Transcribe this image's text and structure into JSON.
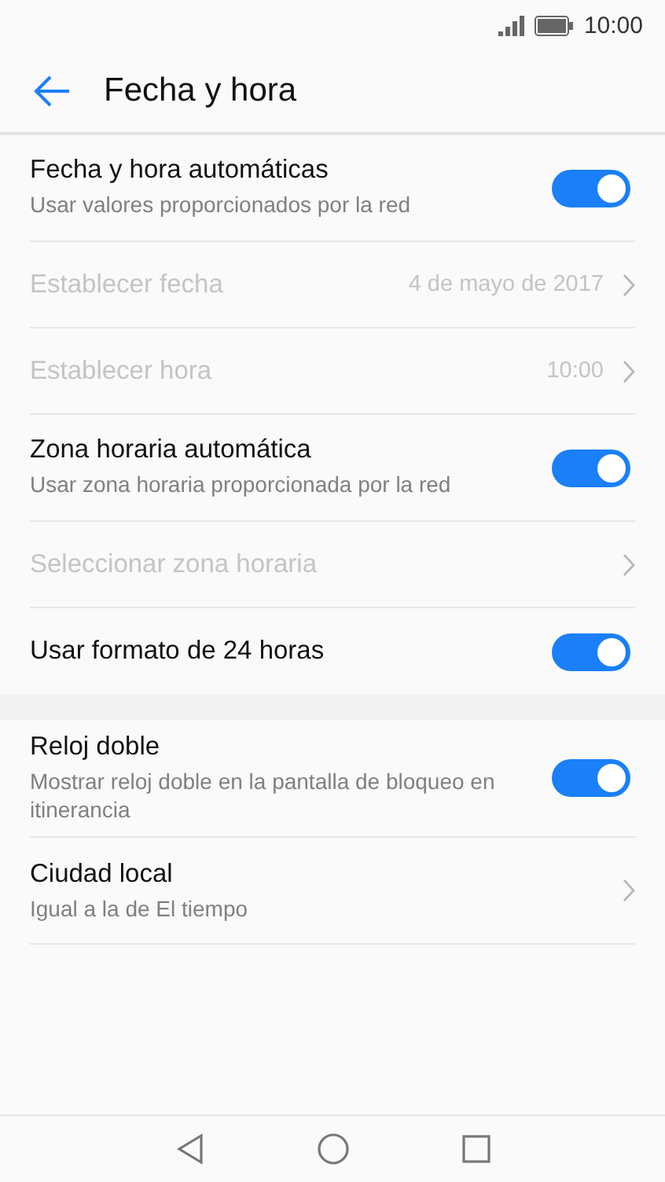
{
  "status_bar": {
    "time": "10:00"
  },
  "header": {
    "title": "Fecha y hora"
  },
  "sections": [
    {
      "rows": [
        {
          "kind": "toggle",
          "title": "Fecha y hora automáticas",
          "subtitle": "Usar valores proporcionados por la red",
          "on": true,
          "disabled": false
        },
        {
          "kind": "link",
          "title": "Establecer fecha",
          "value": "4 de mayo de 2017",
          "disabled": true
        },
        {
          "kind": "link",
          "title": "Establecer hora",
          "value": "10:00",
          "disabled": true
        },
        {
          "kind": "toggle",
          "title": "Zona horaria automática",
          "subtitle": "Usar zona horaria proporcionada por la red",
          "on": true,
          "disabled": false
        },
        {
          "kind": "link",
          "title": "Seleccionar zona horaria",
          "disabled": true
        },
        {
          "kind": "toggle",
          "title": "Usar formato de 24 horas",
          "on": true,
          "disabled": false
        }
      ]
    },
    {
      "rows": [
        {
          "kind": "toggle",
          "title": "Reloj doble",
          "subtitle": "Mostrar reloj doble en la pantalla de bloqueo en itinerancia",
          "on": true,
          "disabled": false
        },
        {
          "kind": "link",
          "title": "Ciudad local",
          "subtitle": "Igual a la de El tiempo",
          "disabled": false
        }
      ]
    }
  ]
}
